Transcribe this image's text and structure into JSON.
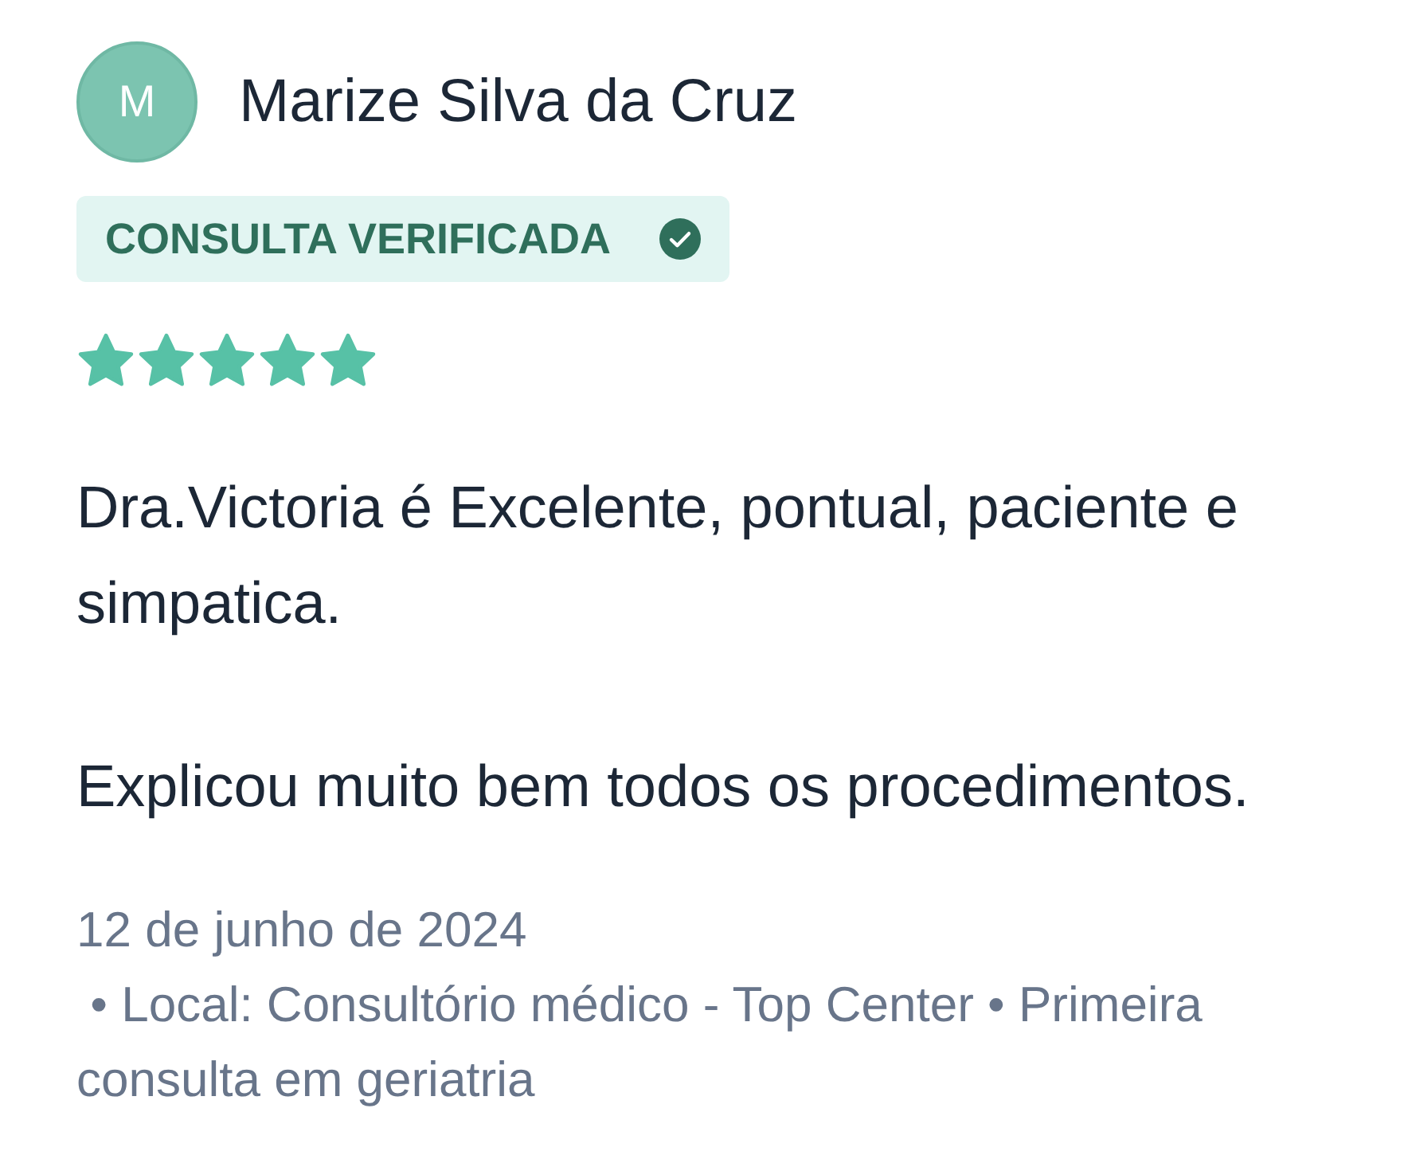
{
  "review": {
    "avatar_initial": "M",
    "author": "Marize Silva da Cruz",
    "badge": "CONSULTA VERIFICADA",
    "stars": 5,
    "paragraphs": [
      "Dra.Victoria é Excelente, pontual, paciente e simpatica.",
      "Explicou muito bem todos os procedimentos."
    ],
    "date": "12 de junho de 2024",
    "details": " • Local: Consultório médico - Top Center • Primeira consulta em geriatria"
  }
}
